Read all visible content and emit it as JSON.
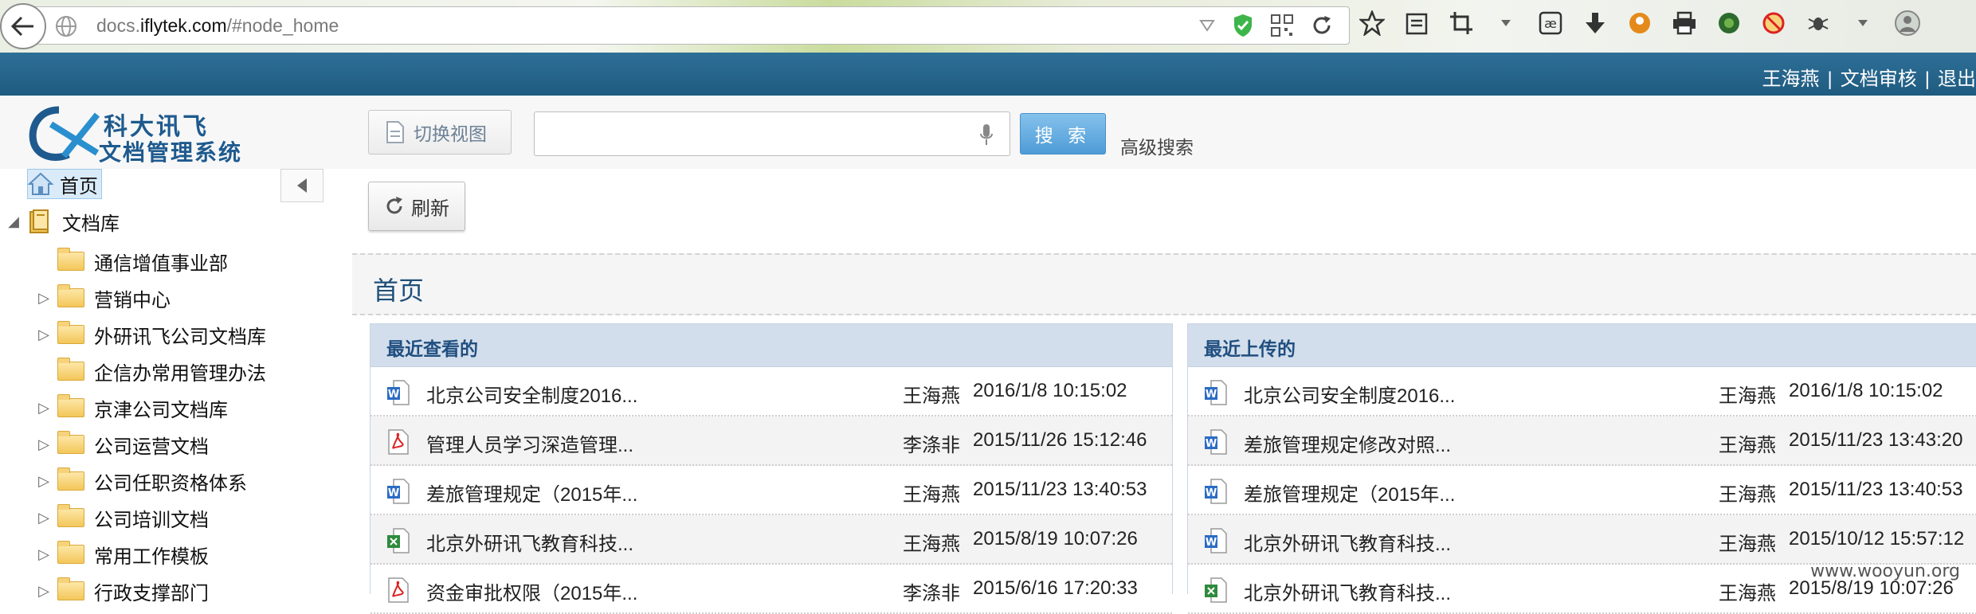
{
  "browser": {
    "url_prefix": "docs.",
    "url_domain": "iflytek.com",
    "url_suffix": "/#node_home"
  },
  "topbar": {
    "user": "王海燕",
    "sep": "|",
    "review": "文档审核",
    "logout": "退出"
  },
  "header": {
    "logo_line1": "科大讯飞",
    "logo_line2": "文档管理系统",
    "switch_view": "切换视图",
    "search_placeholder": "",
    "search_button": "搜 索",
    "advanced_search": "高级搜索"
  },
  "sidebar": {
    "home": "首页",
    "library": "文档库",
    "items": [
      {
        "label": "通信增值事业部",
        "expandable": false
      },
      {
        "label": "营销中心",
        "expandable": true
      },
      {
        "label": "外研讯飞公司文档库",
        "expandable": true
      },
      {
        "label": "企信办常用管理办法",
        "expandable": false
      },
      {
        "label": "京津公司文档库",
        "expandable": true
      },
      {
        "label": "公司运营文档",
        "expandable": true
      },
      {
        "label": "公司任职资格体系",
        "expandable": true
      },
      {
        "label": "公司培训文档",
        "expandable": true
      },
      {
        "label": "常用工作模板",
        "expandable": true
      },
      {
        "label": "行政支撑部门",
        "expandable": true
      }
    ]
  },
  "main": {
    "refresh": "刷新",
    "page_title": "首页",
    "recent_viewed": {
      "title": "最近查看的",
      "rows": [
        {
          "type": "word",
          "name": "北京公司安全制度2016...",
          "user": "王海燕",
          "time": "2016/1/8 10:15:02"
        },
        {
          "type": "pdf",
          "name": "管理人员学习深造管理...",
          "user": "李涤非",
          "time": "2015/11/26 15:12:46"
        },
        {
          "type": "word",
          "name": "差旅管理规定（2015年...",
          "user": "王海燕",
          "time": "2015/11/23 13:40:53"
        },
        {
          "type": "excel",
          "name": "北京外研讯飞教育科技...",
          "user": "王海燕",
          "time": "2015/8/19 10:07:26"
        },
        {
          "type": "pdf",
          "name": "资金审批权限（2015年...",
          "user": "李涤非",
          "time": "2015/6/16 17:20:33"
        }
      ]
    },
    "recent_uploaded": {
      "title": "最近上传的",
      "rows": [
        {
          "type": "word",
          "name": "北京公司安全制度2016...",
          "user": "王海燕",
          "time": "2016/1/8 10:15:02"
        },
        {
          "type": "word",
          "name": "差旅管理规定修改对照...",
          "user": "王海燕",
          "time": "2015/11/23 13:43:20"
        },
        {
          "type": "word",
          "name": "差旅管理规定（2015年...",
          "user": "王海燕",
          "time": "2015/11/23 13:40:53"
        },
        {
          "type": "word",
          "name": "北京外研讯飞教育科技...",
          "user": "王海燕",
          "time": "2015/10/12 15:57:12"
        },
        {
          "type": "excel",
          "name": "北京外研讯飞教育科技...",
          "user": "王海燕",
          "time": "2015/8/19 10:07:26"
        }
      ]
    }
  },
  "watermark": "www.wooyun.org",
  "colors": {
    "topbar": "#1f5b80",
    "panel_header": "#d3deec",
    "accent": "#4d9bd6"
  }
}
